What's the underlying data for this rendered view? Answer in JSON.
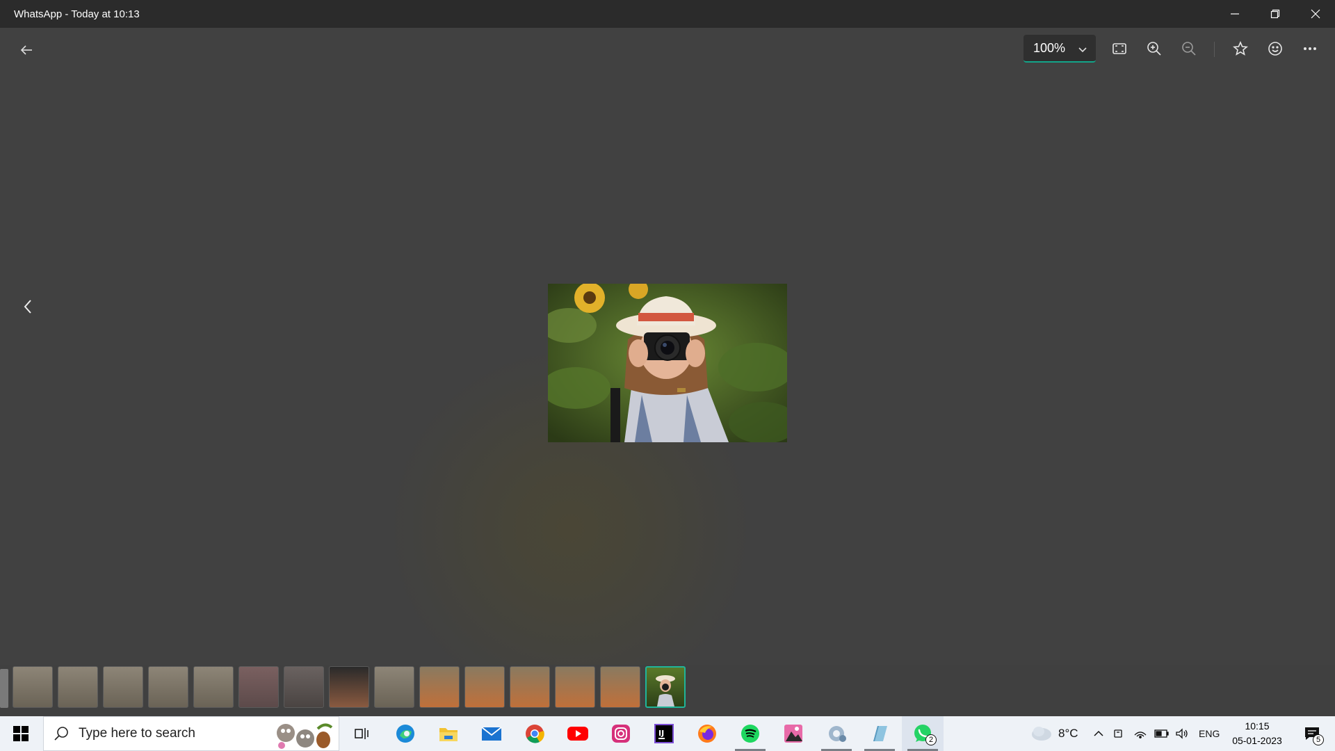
{
  "window": {
    "title": "WhatsApp - Today at 10:13"
  },
  "toolbar": {
    "zoom_value": "100%",
    "icons": [
      "back-arrow-icon",
      "fit-screen-icon",
      "zoom-in-icon",
      "zoom-out-icon",
      "star-icon",
      "emoji-icon",
      "more-icon"
    ]
  },
  "viewer": {
    "prev_icon": "chevron-left-icon",
    "thumbnail_count": 15,
    "active_thumbnail_index": 14
  },
  "taskbar": {
    "search_placeholder": "Type here to search",
    "apps": [
      "task-view",
      "edge",
      "file-explorer",
      "mail",
      "chrome",
      "youtube",
      "instagram",
      "intellij",
      "firefox",
      "spotify",
      "photo-app",
      "settings",
      "notepad",
      "whatsapp"
    ],
    "whatsapp_badge": "2",
    "weather_temp": "8°C",
    "language": "ENG",
    "time": "10:15",
    "date": "05-01-2023",
    "notification_count": "5"
  },
  "colors": {
    "accent": "#13a58a",
    "viewer_bg": "#404040",
    "titlebar_bg": "#2b2b2b",
    "taskbar_bg": "#eef2f7"
  }
}
